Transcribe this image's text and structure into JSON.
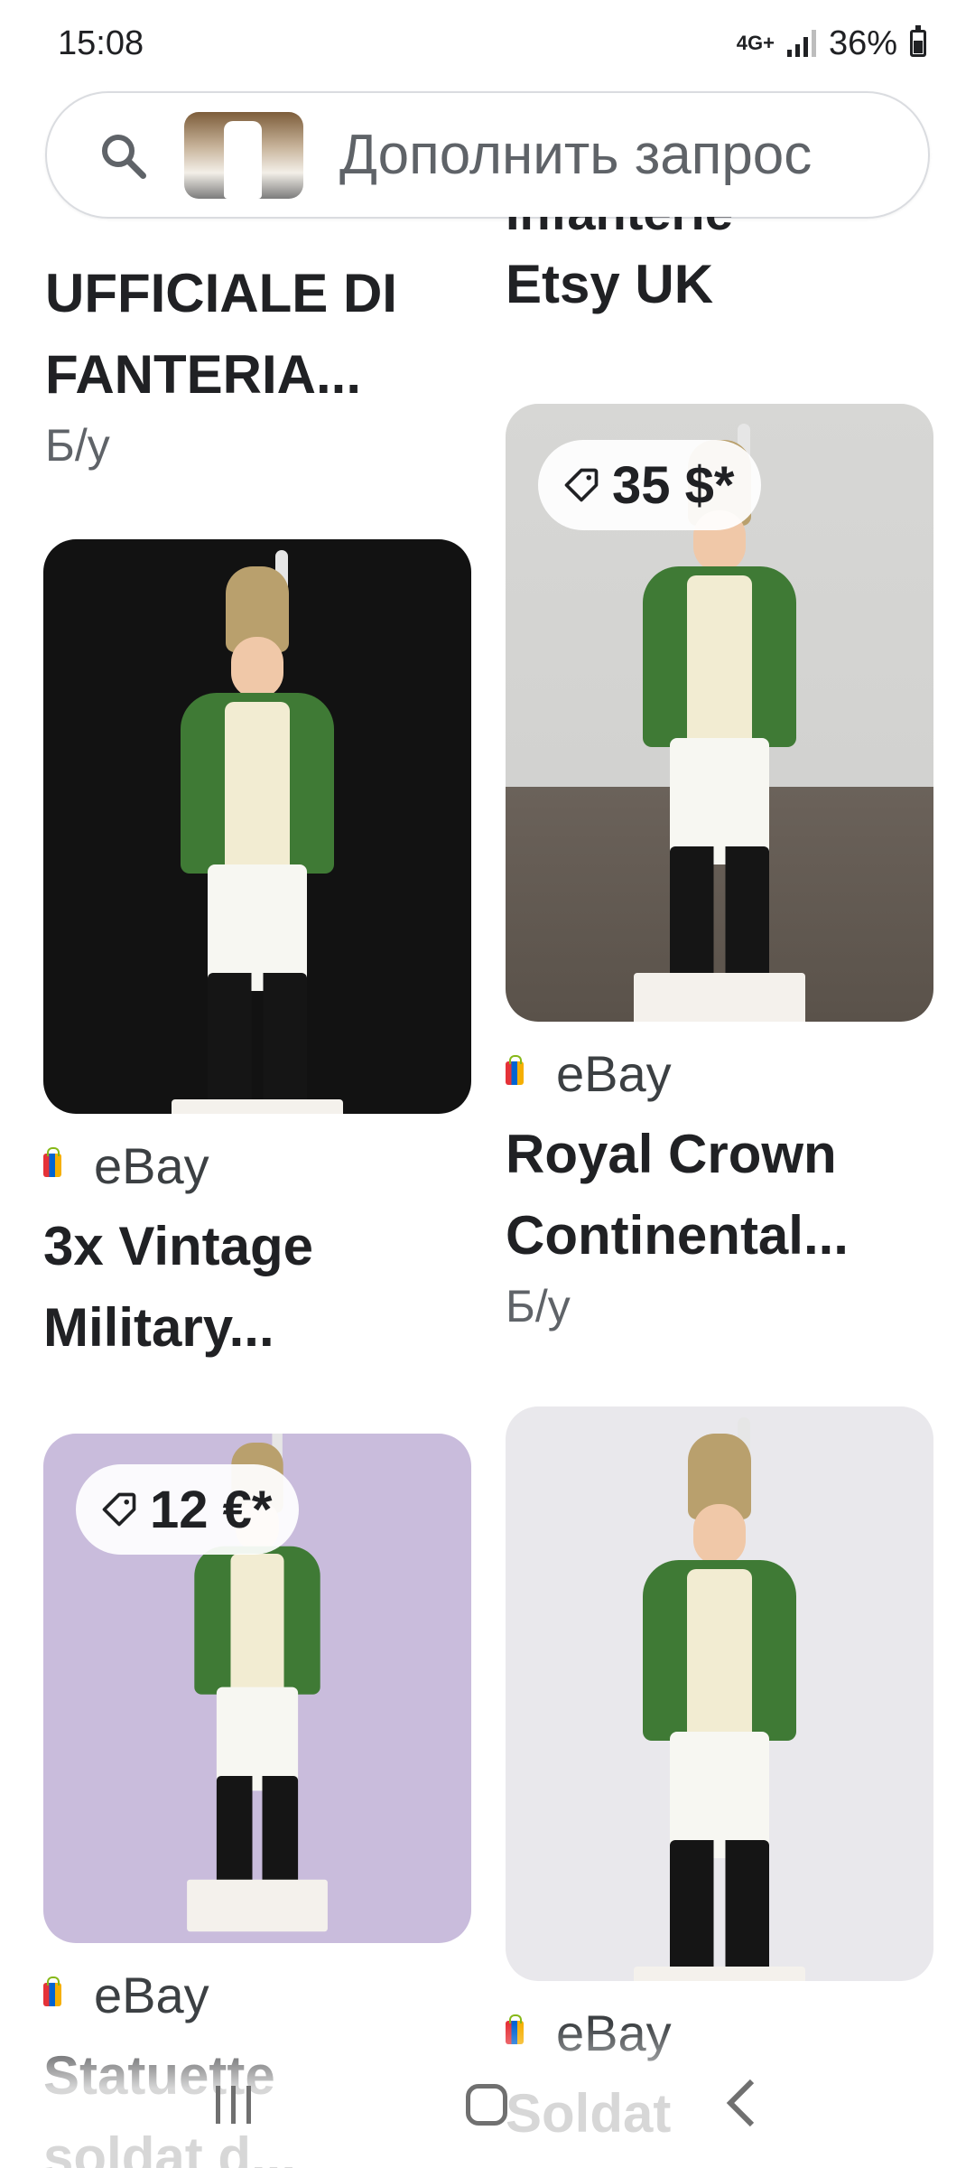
{
  "status_bar": {
    "time": "15:08",
    "network": "4G+",
    "battery": "36%"
  },
  "search": {
    "placeholder": "Дополнить запрос"
  },
  "results": {
    "left_top": {
      "title_line1": "UFFICIALE DI",
      "title_line2": "FANTERIA...",
      "condition": "Б/у"
    },
    "right_top": {
      "partial_title": "Infanterie",
      "source": "Etsy UK"
    },
    "left_1": {
      "source": "eBay",
      "title_line1": "3x Vintage",
      "title_line2": "Military..."
    },
    "right_1": {
      "price": "35 $*",
      "source": "eBay",
      "title_line1": "Royal Crown",
      "title_line2": "Continental...",
      "condition": "Б/у"
    },
    "left_2": {
      "price": "12 €*",
      "source": "eBay",
      "title_line1": "Statuette",
      "title_line2": "soldat d..."
    },
    "right_2": {
      "source": "eBay",
      "title_line1": "Soldat"
    }
  },
  "colors": {
    "accent_text": "#202124",
    "muted_text": "#5f6368",
    "border": "#dadce0"
  },
  "icons": [
    "search-icon",
    "price-tag-icon",
    "ebay-favicon",
    "recent-apps-icon",
    "home-icon",
    "back-icon"
  ]
}
